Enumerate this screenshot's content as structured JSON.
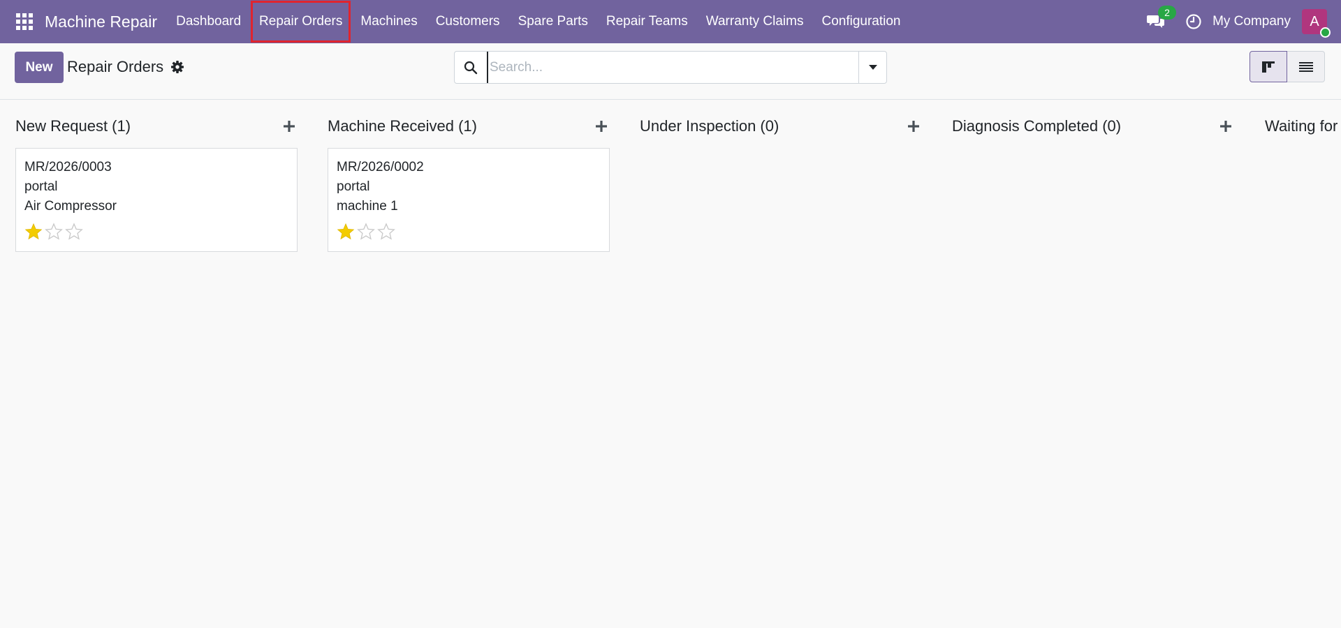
{
  "navbar": {
    "app_name": "Machine Repair",
    "menu": [
      {
        "label": "Dashboard"
      },
      {
        "label": "Repair Orders"
      },
      {
        "label": "Machines"
      },
      {
        "label": "Customers"
      },
      {
        "label": "Spare Parts"
      },
      {
        "label": "Repair Teams"
      },
      {
        "label": "Warranty Claims"
      },
      {
        "label": "Configuration"
      }
    ],
    "messages_count": "2",
    "company": "My Company",
    "avatar_letter": "A"
  },
  "control_panel": {
    "new_label": "New",
    "breadcrumb": "Repair Orders",
    "search_placeholder": "Search..."
  },
  "kanban": {
    "columns": [
      {
        "title": "New Request (1)",
        "cards": [
          {
            "ref": "MR/2026/0003",
            "customer": "portal",
            "machine": "Air Compressor",
            "priority_stars": 1,
            "max_stars": 3
          }
        ]
      },
      {
        "title": "Machine Received (1)",
        "cards": [
          {
            "ref": "MR/2026/0002",
            "customer": "portal",
            "machine": "machine 1",
            "priority_stars": 1,
            "max_stars": 3
          }
        ]
      },
      {
        "title": "Under Inspection (0)",
        "cards": []
      },
      {
        "title": "Diagnosis Completed (0)",
        "cards": []
      },
      {
        "title": "Waiting for",
        "cards": []
      }
    ]
  },
  "colors": {
    "brand": "#71639e",
    "star_filled": "#f3cc00",
    "star_empty": "#c8c8c8",
    "badge": "#28a745",
    "avatar": "#b0367e"
  }
}
